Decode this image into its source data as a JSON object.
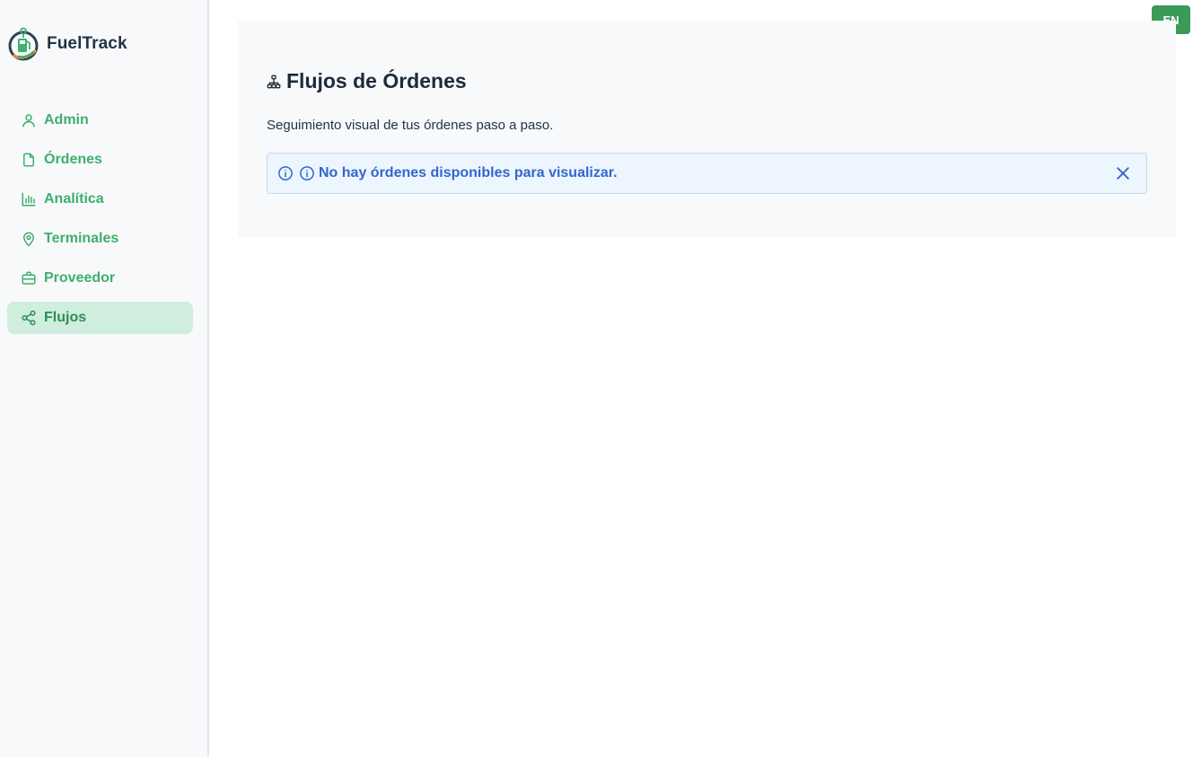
{
  "brand": {
    "name": "FuelTrack",
    "logo_icon": "fuel-pump-logo"
  },
  "sidebar": {
    "items": [
      {
        "label": "Admin",
        "icon": "user-icon",
        "active": false
      },
      {
        "label": "Órdenes",
        "icon": "document-icon",
        "active": false
      },
      {
        "label": "Analítica",
        "icon": "bar-chart-icon",
        "active": false
      },
      {
        "label": "Terminales",
        "icon": "map-pin-icon",
        "active": false
      },
      {
        "label": "Proveedor",
        "icon": "briefcase-icon",
        "active": false
      },
      {
        "label": "Flujos",
        "icon": "share-icon",
        "active": true
      }
    ]
  },
  "header": {
    "lang_label": "EN"
  },
  "main": {
    "title": "Flujos de Órdenes",
    "title_icon": "sitemap-icon",
    "subtitle": "Seguimiento visual de tus órdenes paso a paso.",
    "alert": {
      "text": "No hay órdenes disponibles para visualizar.",
      "icon": "info-icon",
      "close_icon": "close-icon"
    }
  },
  "colors": {
    "accent_green": "#3faf6d",
    "active_bg": "#cfeedd",
    "lang_button": "#3b9a55",
    "alert_text": "#3366cc",
    "alert_bg": "#edf5fe"
  }
}
